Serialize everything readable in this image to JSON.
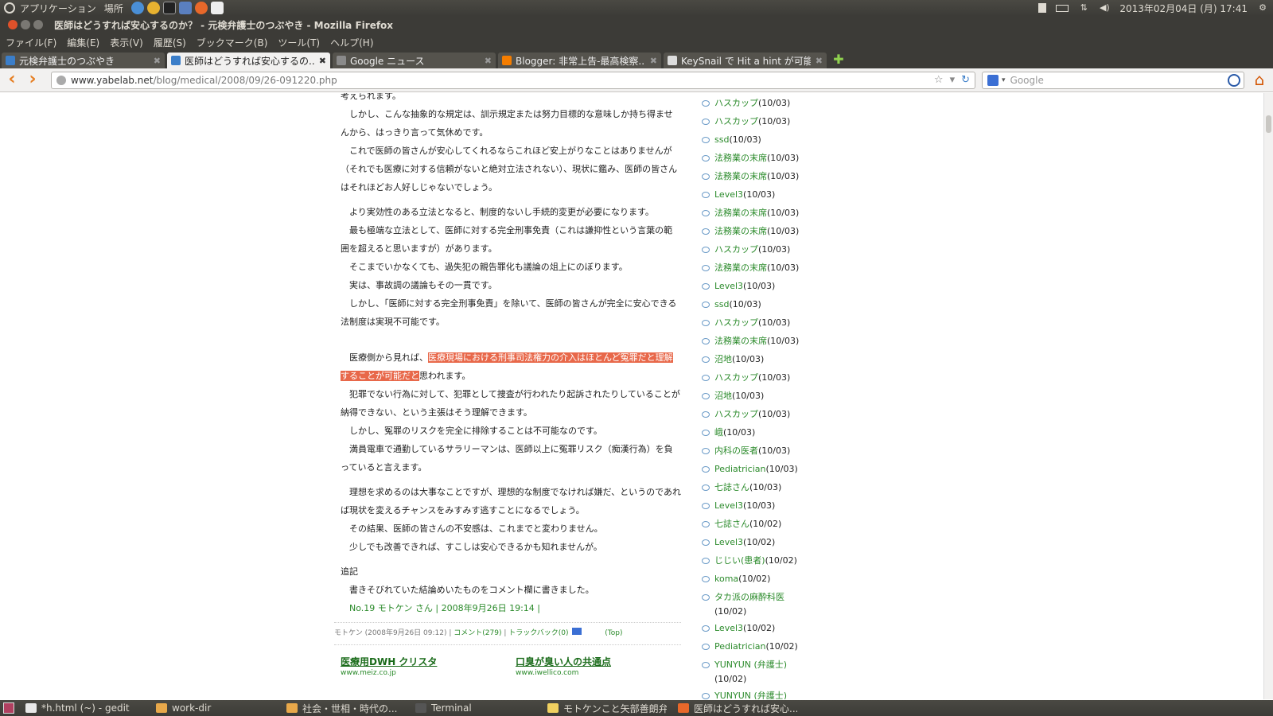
{
  "top_panel": {
    "menus": [
      "アプリケーション",
      "場所"
    ],
    "datetime": "2013年02月04日 (月) 17:41"
  },
  "window": {
    "title": "医師はどうすれば安心するのか？ - 元検弁護士のつぶやき - Mozilla Firefox"
  },
  "menu_bar": [
    "ファイル(F)",
    "編集(E)",
    "表示(V)",
    "履歴(S)",
    "ブックマーク(B)",
    "ツール(T)",
    "ヘルプ(H)"
  ],
  "tabs": [
    {
      "label": "元検弁護士のつぶやき",
      "active": false,
      "favicon_color": "#3b7ec9"
    },
    {
      "label": "医師はどうすれば安心するの...",
      "active": true,
      "favicon_color": "#3b7ec9"
    },
    {
      "label": "Google ニュース",
      "active": false,
      "favicon_color": "#8a8a8a"
    },
    {
      "label": "Blogger: 非常上告-最高検察...",
      "active": false,
      "favicon_color": "#f57d00"
    },
    {
      "label": "KeySnail で Hit a hint が可能...",
      "active": false,
      "favicon_color": "#dddddd"
    }
  ],
  "nav": {
    "url_host": "www.yabelab.net",
    "url_path": "/blog/medical/2008/09/26-091220.php",
    "search_placeholder": "Google"
  },
  "article": {
    "paragraphs": [
      "考えられます。",
      "　しかし、こんな抽象的な規定は、訓示規定または努力目標的な意味しか持ち得ませんから、はっきり言って気休めです。",
      "　これで医師の皆さんが安心してくれるならこれほど安上がりなことはありませんが（それでも医療に対する信頼がないと絶対立法されない）、現状に鑑み、医師の皆さんはそれほどお人好しじゃないでしょう。",
      "　より実効性のある立法となると、制度的ないし手続的変更が必要になります。",
      "　最も極端な立法として、医師に対する完全刑事免責（これは謙抑性という言葉の範囲を超えると思いますが）があります。",
      "　そこまでいかなくても、過失犯の親告罪化も議論の俎上にのぼります。",
      "　実は、事故調の議論もその一貫です。",
      "　しかし、「医師に対する完全刑事免責」を除いて、医師の皆さんが完全に安心できる法制度は実現不可能です。"
    ],
    "highlight_pre": "　医療側から見れば、",
    "highlight": "医療現場における刑事司法権力の介入はほとんど冤罪だと理解することが可能だと",
    "highlight_post": "思われます。",
    "paragraphs2": [
      "　犯罪でない行為に対して、犯罪として捜査が行われたり起訴されたりしていることが納得できない、という主張はそう理解できます。",
      "　しかし、冤罪のリスクを完全に排除することは不可能なのです。",
      "　満員電車で通勤しているサラリーマンは、医師以上に冤罪リスク（痴漢行為）を負っていると言えます。"
    ],
    "paragraphs3": [
      "　理想を求めるのは大事なことですが、理想的な制度でなければ嫌だ、というのであれば現状を変えるチャンスをみすみす逃すことになるでしょう。",
      "　その結果、医師の皆さんの不安感は、これまでと変わりません。",
      "　少しでも改善できれば、すこしは安心できるかも知れませんが。"
    ],
    "postscript_heading": "追記",
    "postscript": "　書きそびれていた結論めいたものをコメント欄に書きました。",
    "signature": "　No.19 モトケン さん | 2008年9月26日 19:14 |",
    "meta_author": "モトケン (2008年9月26日 09:12) | ",
    "meta_comments": "コメント(279)",
    "meta_sep": " | ",
    "meta_trackback": "トラックバック(0)",
    "meta_top": "(Top)",
    "ads": [
      {
        "title": "医療用DWH クリスタ",
        "url": "www.meiz.co.jp"
      },
      {
        "title": "口臭が臭い人の共通点",
        "url": "www.iwellico.com"
      }
    ]
  },
  "sidebar": {
    "comments": [
      {
        "name": "ハスカップ",
        "date": "(10/03)"
      },
      {
        "name": "ハスカップ",
        "date": "(10/03)"
      },
      {
        "name": "ssd",
        "date": "(10/03)"
      },
      {
        "name": "法務業の末席",
        "date": "(10/03)"
      },
      {
        "name": "法務業の末席",
        "date": "(10/03)"
      },
      {
        "name": "Level3",
        "date": "(10/03)"
      },
      {
        "name": "法務業の末席",
        "date": "(10/03)"
      },
      {
        "name": "法務業の末席",
        "date": "(10/03)"
      },
      {
        "name": "ハスカップ",
        "date": "(10/03)"
      },
      {
        "name": "法務業の末席",
        "date": "(10/03)"
      },
      {
        "name": "Level3",
        "date": "(10/03)"
      },
      {
        "name": "ssd",
        "date": "(10/03)"
      },
      {
        "name": "ハスカップ",
        "date": "(10/03)"
      },
      {
        "name": "法務業の末席",
        "date": "(10/03)"
      },
      {
        "name": "沼地",
        "date": "(10/03)"
      },
      {
        "name": "ハスカップ",
        "date": "(10/03)"
      },
      {
        "name": "沼地",
        "date": "(10/03)"
      },
      {
        "name": "ハスカップ",
        "date": "(10/03)"
      },
      {
        "name": "峨",
        "date": "(10/03)"
      },
      {
        "name": "内科の医者",
        "date": "(10/03)"
      },
      {
        "name": "Pediatrician",
        "date": "(10/03)"
      },
      {
        "name": "七誌さん",
        "date": "(10/03)"
      },
      {
        "name": "Level3",
        "date": "(10/03)"
      },
      {
        "name": "七誌さん",
        "date": "(10/02)"
      },
      {
        "name": "Level3",
        "date": "(10/02)"
      },
      {
        "name": "じじい(患者)",
        "date": "(10/02)"
      },
      {
        "name": "koma",
        "date": "(10/02)"
      },
      {
        "name": "タカ派の麻酔科医",
        "date": "(10/02)",
        "wrap": true
      },
      {
        "name": "Level3",
        "date": "(10/02)"
      },
      {
        "name": "Pediatrician",
        "date": "(10/02)"
      },
      {
        "name": "YUNYUN (弁護士)",
        "date": "(10/02)",
        "wrap": true
      },
      {
        "name": "YUNYUN (弁護士)",
        "date": ""
      }
    ]
  },
  "taskbar": [
    {
      "label": "*h.html (~) - gedit",
      "color": "#e8e8e8"
    },
    {
      "label": "work-dir",
      "color": "#e8a84a"
    },
    {
      "label": "社会・世相・時代の...",
      "color": "#e8a84a"
    },
    {
      "label": "Terminal",
      "color": "#555555"
    },
    {
      "label": "モトケンこと矢部善朗弁...",
      "color": "#f0d060"
    },
    {
      "label": "医師はどうすれば安心...",
      "color": "#e8682a"
    }
  ]
}
